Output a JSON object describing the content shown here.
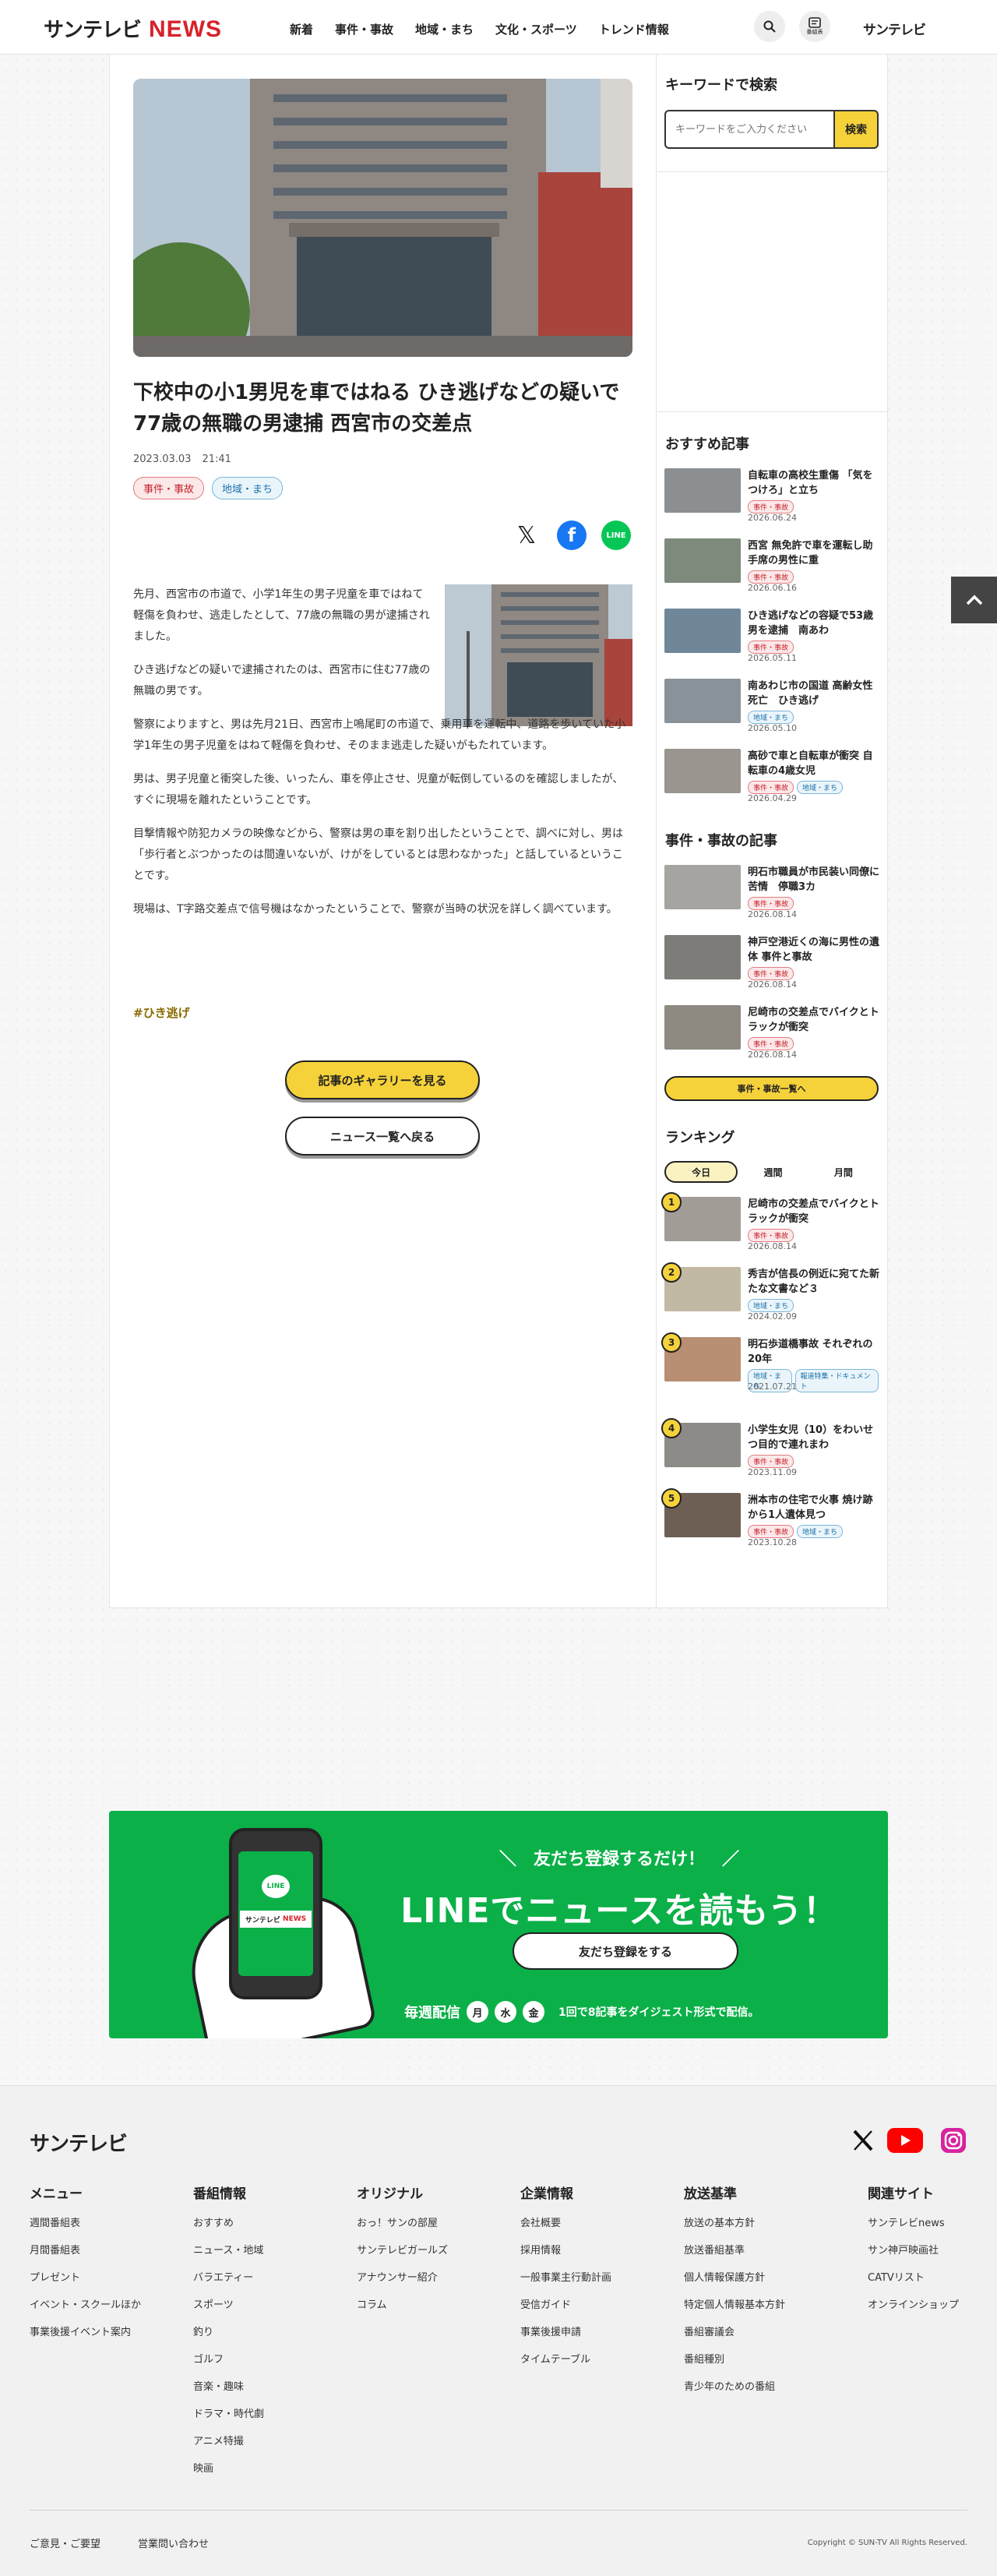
{
  "header": {
    "logo_sun": "サンテレビ",
    "logo_news": "NEWS",
    "nav": [
      "新着",
      "事件・事故",
      "地域・まち",
      "文化・スポーツ",
      "トレンド情報"
    ],
    "tv_label": "番組表",
    "right_logo": "サンテレビ"
  },
  "article": {
    "title": "下校中の小1男児を車ではねる ひき逃げなどの疑いで77歳の無職の男逮捕 西宮市の交差点",
    "date": "2023.03.03",
    "time": "21:41",
    "tags": [
      "事件・事故",
      "地域・まち"
    ],
    "share": {
      "x": "𝕏",
      "facebook": "f",
      "line": "LINE"
    },
    "paragraphs": [
      "先月、西宮市の市道で、小学1年生の男子児童を車ではねて軽傷を負わせ、逃走したとして、77歳の無職の男が逮捕されました。",
      "ひき逃げなどの疑いで逮捕されたのは、西宮市に住む77歳の無職の男です。",
      "警察によりますと、男は先月21日、西宮市上鳴尾町の市道で、乗用車を運転中、道路を歩いていた小学1年生の男子児童をはねて軽傷を負わせ、そのまま逃走した疑いがもたれています。",
      "男は、男子児童と衝突した後、いったん、車を停止させ、児童が転倒しているのを確認しましたが、すぐに現場を離れたということです。",
      "目撃情報や防犯カメラの映像などから、警察は男の車を割り出したということで、調べに対し、男は「歩行者とぶつかったのは間違いないが、けがをしているとは思わなかった」と話しているということです。",
      "現場は、T字路交差点で信号機はなかったということで、警察が当時の状況を詳しく調べています。"
    ],
    "hashtag": "#ひき逃げ",
    "gallery_button": "記事のギャラリーを見る",
    "back_button": "ニュース一覧へ戻る"
  },
  "sidebar": {
    "keyword_heading": "キーワードで検索",
    "keyword_placeholder": "キーワードをご入力ください",
    "keyword_button": "検索",
    "recommended_heading": "おすすめ記事",
    "recommended": [
      {
        "title": "自転車の高校生重傷 「気をつけろ」と立ち",
        "tags": [
          "事件・事故"
        ],
        "date": "2026.06.24"
      },
      {
        "title": "西宮 無免許で車を運転し助手席の男性に重",
        "tags": [
          "事件・事故"
        ],
        "date": "2026.06.16"
      },
      {
        "title": "ひき逃げなどの容疑で53歳男を逮捕　南あわ",
        "tags": [
          "事件・事故"
        ],
        "date": "2026.05.11"
      },
      {
        "title": "南あわじ市の国道 高齢女性死亡　ひき逃げ",
        "tags": [
          "地域・まち"
        ],
        "date": "2026.05.10"
      },
      {
        "title": "高砂で車と自転車が衝突 自転車の4歳女児",
        "tags": [
          "事件・事故",
          "地域・まち"
        ],
        "date": "2026.04.29"
      }
    ],
    "crime_heading": "事件・事故の記事",
    "crime": [
      {
        "title": "明石市職員が市民装い同僚に苦情　停職3カ",
        "tags": [
          "事件・事故"
        ],
        "date": "2026.08.14"
      },
      {
        "title": "神戸空港近くの海に男性の遺体 事件と事故",
        "tags": [
          "事件・事故"
        ],
        "date": "2026.08.14"
      },
      {
        "title": "尼崎市の交差点でバイクとトラックが衝突",
        "tags": [
          "事件・事故"
        ],
        "date": "2026.08.14"
      }
    ],
    "crime_more": "事件・事故一覧へ",
    "ranking_heading": "ランキング",
    "ranking_tabs": [
      "今日",
      "週間",
      "月間"
    ],
    "ranking": [
      {
        "rank": "1",
        "title": "尼崎市の交差点でバイクとトラックが衝突",
        "tags": [
          "事件・事故"
        ],
        "date": "2026.08.14"
      },
      {
        "rank": "2",
        "title": "秀吉が信長の例近に宛てた新たな文書など３",
        "tags": [
          "地域・まち"
        ],
        "date": "2024.02.09"
      },
      {
        "rank": "3",
        "title": "明石歩道橋事故 それぞれの20年",
        "tags": [
          "地域・まち",
          "報道特集・ドキュメント"
        ],
        "date": "2021.07.21"
      },
      {
        "rank": "4",
        "title": "小学生女児（10）をわいせつ目的で連れまわ",
        "tags": [
          "事件・事故"
        ],
        "date": "2023.11.09"
      },
      {
        "rank": "5",
        "title": "洲本市の住宅で火事 焼け跡から1人遺体見つ",
        "tags": [
          "事件・事故",
          "地域・まち"
        ],
        "date": "2023.10.28"
      }
    ]
  },
  "banner": {
    "sub": "＼　友だち登録するだけ！　／",
    "main": "LINEでニュースを読もう！",
    "button": "友だち登録をする",
    "weekly": "毎週配信",
    "days": [
      "月",
      "水",
      "金"
    ],
    "desc": "1回で8記事をダイジェスト形式で配信。",
    "phone_logo": "LINE",
    "phone_badge_sun": "サンテレビ",
    "phone_badge_news": "NEWS"
  },
  "footer": {
    "logo": "サンテレビ",
    "columns": [
      {
        "heading": "メニュー",
        "links": [
          "週間番組表",
          "月間番組表",
          "プレゼント",
          "イベント・スクールほか",
          "事業後援イベント案内"
        ]
      },
      {
        "heading": "番組情報",
        "links": [
          "おすすめ",
          "ニュース・地域",
          "バラエティー",
          "スポーツ",
          "釣り",
          "ゴルフ",
          "音楽・趣味",
          "ドラマ・時代劇",
          "アニメ特撮",
          "映画"
        ]
      },
      {
        "heading": "オリジナル",
        "links": [
          "おっ！サンの部屋",
          "サンテレビガールズ",
          "アナウンサー紹介",
          "コラム"
        ]
      },
      {
        "heading": "企業情報",
        "links": [
          "会社概要",
          "採用情報",
          "一般事業主行動計画",
          "受信ガイド",
          "事業後援申請",
          "タイムテーブル"
        ]
      },
      {
        "heading": "放送基準",
        "links": [
          "放送の基本方針",
          "放送番組基準",
          "個人情報保護方針",
          "特定個人情報基本方針",
          "番組審議会",
          "番組種別",
          "青少年のための番組"
        ]
      },
      {
        "heading": "関連サイト",
        "links": [
          "サンテレビnews",
          "サン神戸映画社",
          "CATVリスト",
          "オンラインショップ"
        ]
      }
    ],
    "bottom_links": [
      "ご意見・ご要望",
      "営業問い合わせ"
    ],
    "copyright": "Copyright © SUN-TV All Rights Reserved."
  },
  "colors": {
    "accent_yellow": "#f6d23a",
    "brand_red": "#d7222a",
    "line_green": "#0bb048"
  }
}
